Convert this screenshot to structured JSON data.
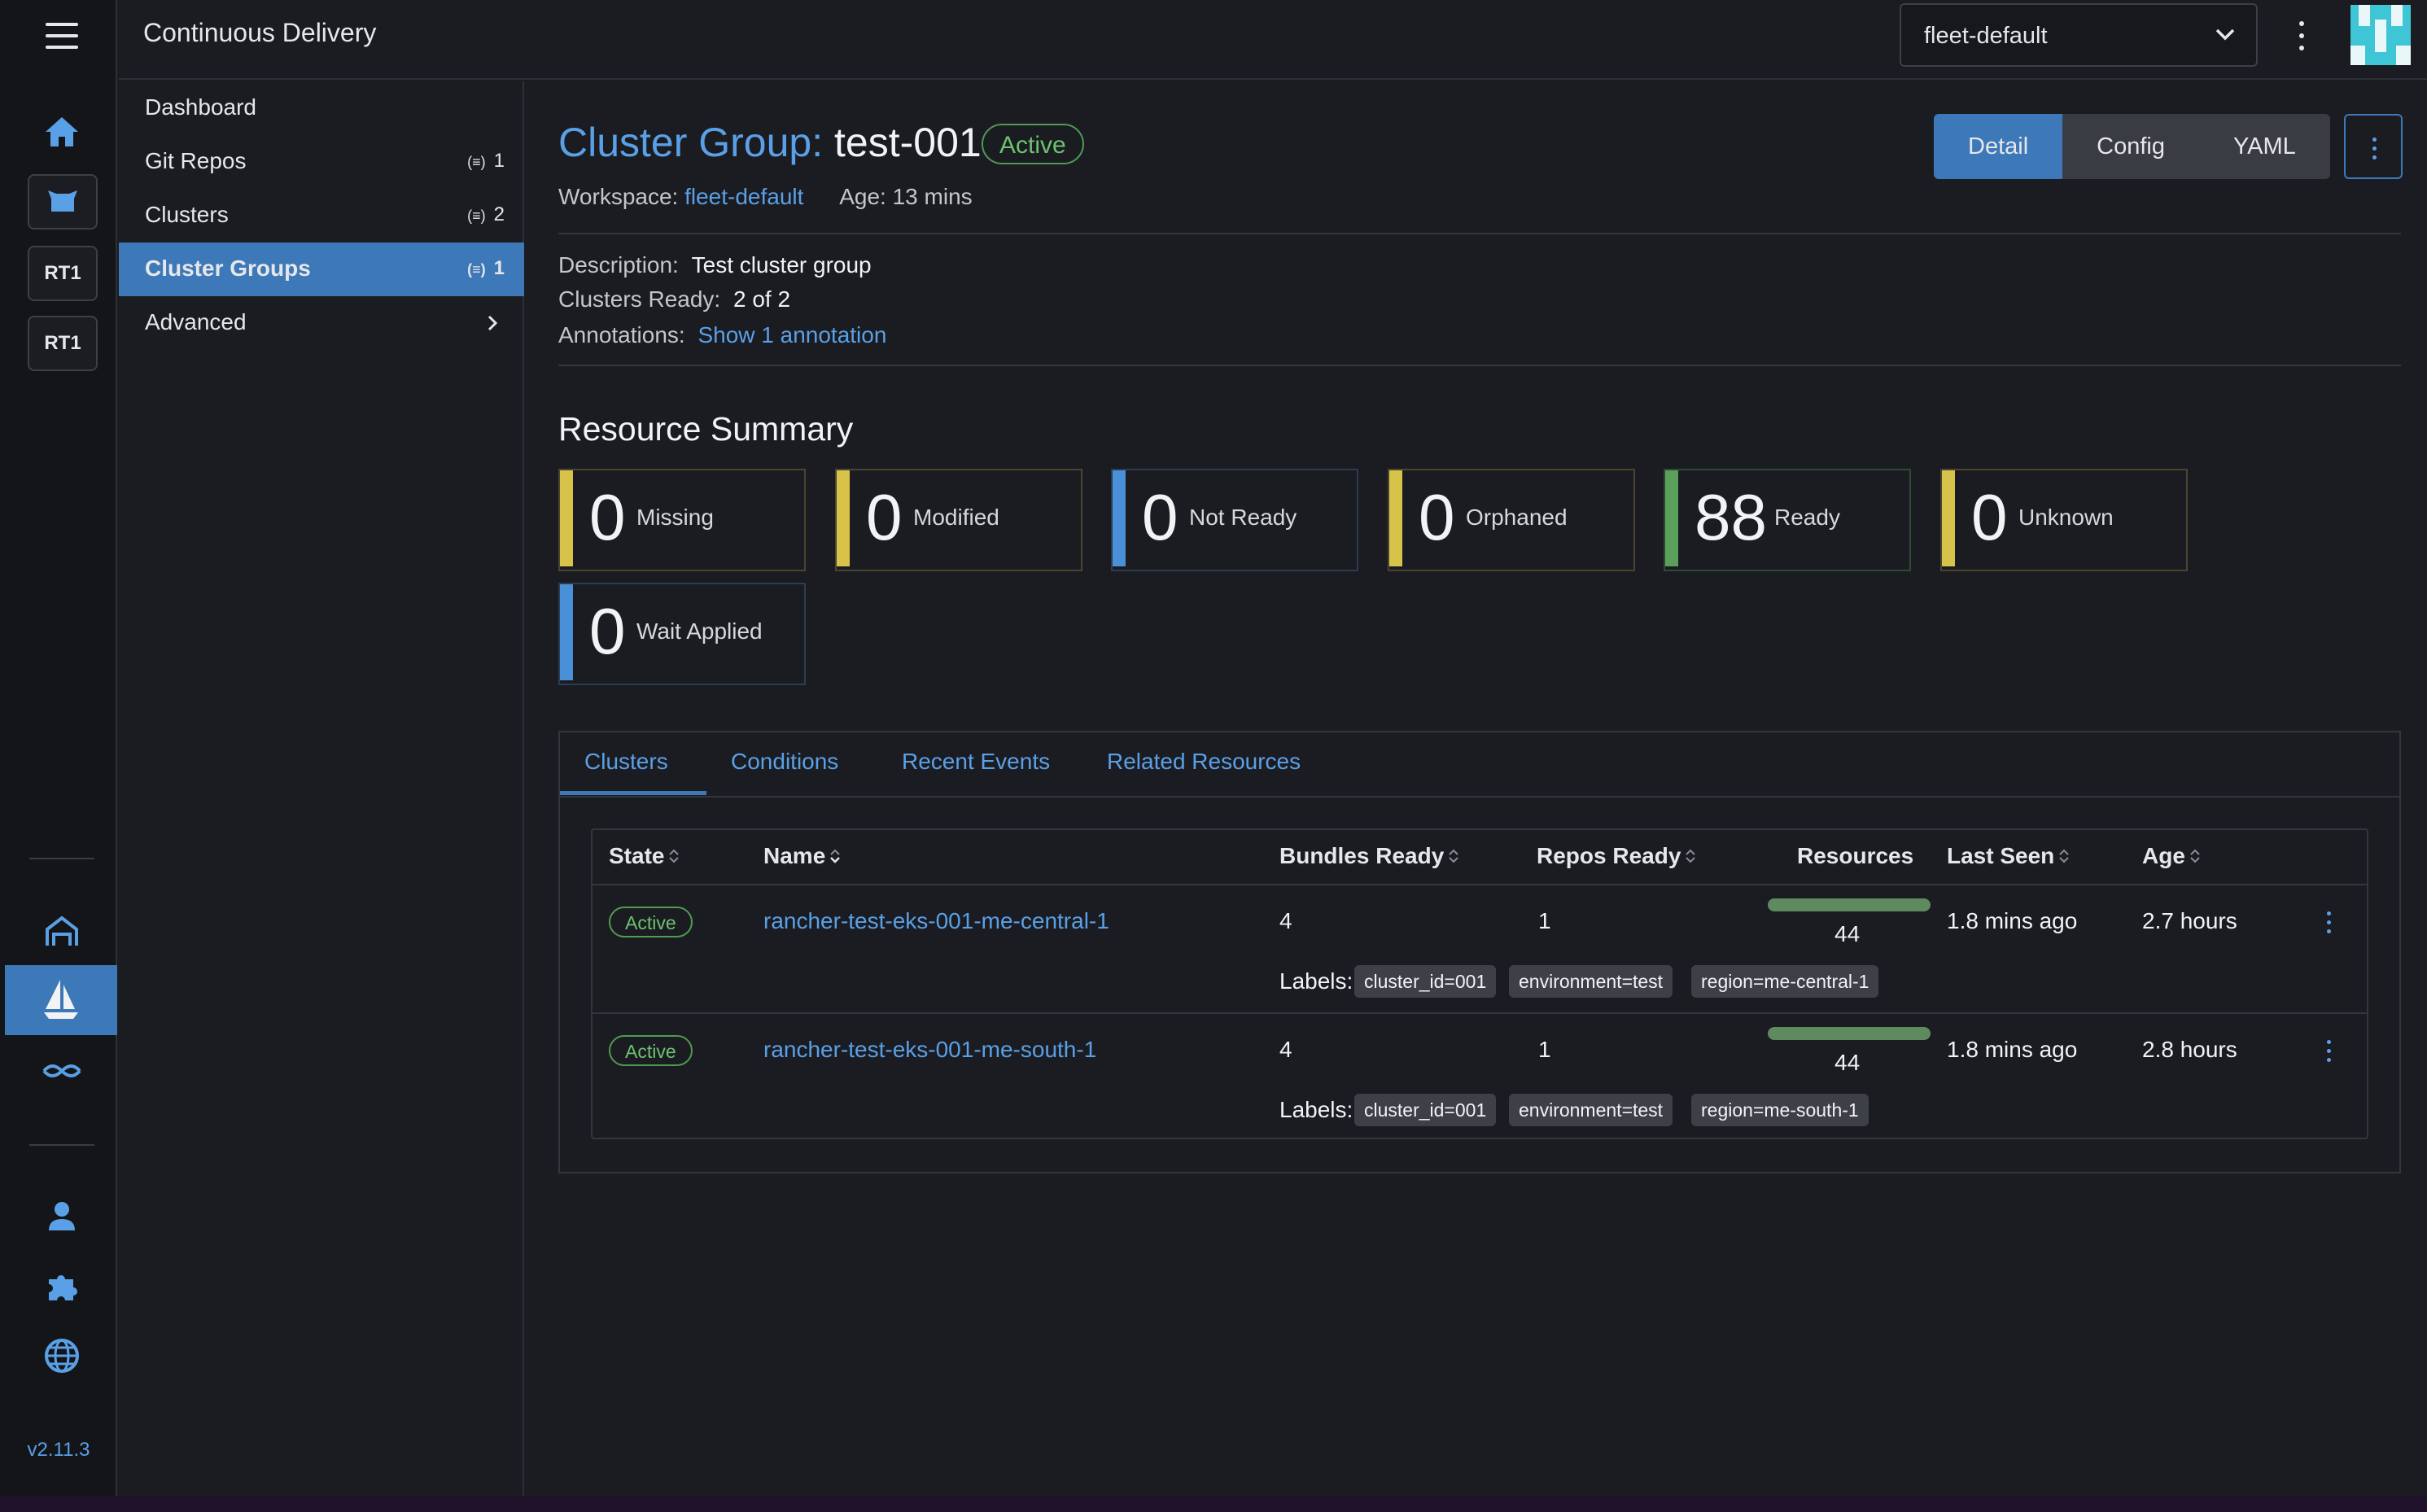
{
  "header": {
    "app_title": "Continuous Delivery",
    "workspace_select": "fleet-default"
  },
  "rail": {
    "tags": [
      "RT1",
      "RT1"
    ],
    "version": "v2.11.3"
  },
  "sidenav": {
    "items": [
      {
        "label": "Dashboard",
        "count": ""
      },
      {
        "label": "Git Repos",
        "count": "1"
      },
      {
        "label": "Clusters",
        "count": "2"
      },
      {
        "label": "Cluster Groups",
        "count": "1"
      },
      {
        "label": "Advanced",
        "count": ""
      }
    ]
  },
  "page": {
    "title_prefix": "Cluster Group:",
    "title_name": "test-001",
    "state": "Active",
    "workspace_label": "Workspace:",
    "workspace_value": "fleet-default",
    "age_label": "Age:",
    "age_value": "13 mins",
    "view_buttons": [
      "Detail",
      "Config",
      "YAML"
    ]
  },
  "details": {
    "description_label": "Description:",
    "description_value": "Test cluster group",
    "clusters_ready_label": "Clusters Ready:",
    "clusters_ready_value": "2 of 2",
    "annotations_label": "Annotations:",
    "annotations_link": "Show 1 annotation"
  },
  "resource_summary": {
    "title": "Resource Summary",
    "cards": [
      {
        "count": "0",
        "label": "Missing",
        "color": "#d8c34a"
      },
      {
        "count": "0",
        "label": "Modified",
        "color": "#d8c34a"
      },
      {
        "count": "0",
        "label": "Not Ready",
        "color": "#4a90d9"
      },
      {
        "count": "0",
        "label": "Orphaned",
        "color": "#d8c34a"
      },
      {
        "count": "88",
        "label": "Ready",
        "color": "#5aa05c"
      },
      {
        "count": "0",
        "label": "Unknown",
        "color": "#d8c34a"
      },
      {
        "count": "0",
        "label": "Wait Applied",
        "color": "#4a90d9"
      }
    ]
  },
  "tabs": [
    "Clusters",
    "Conditions",
    "Recent Events",
    "Related Resources"
  ],
  "clusters_table": {
    "columns": [
      "State",
      "Name",
      "Bundles Ready",
      "Repos Ready",
      "Resources",
      "Last Seen",
      "Age"
    ],
    "labels_prefix": "Labels:",
    "rows": [
      {
        "state": "Active",
        "name": "rancher-test-eks-001-me-central-1",
        "bundles_ready": "4",
        "repos_ready": "1",
        "resources": "44",
        "last_seen": "1.8 mins ago",
        "age": "2.7 hours",
        "labels": [
          "cluster_id=001",
          "environment=test",
          "region=me-central-1"
        ]
      },
      {
        "state": "Active",
        "name": "rancher-test-eks-001-me-south-1",
        "bundles_ready": "4",
        "repos_ready": "1",
        "resources": "44",
        "last_seen": "1.8 mins ago",
        "age": "2.8 hours",
        "labels": [
          "cluster_id=001",
          "environment=test",
          "region=me-south-1"
        ]
      }
    ]
  }
}
